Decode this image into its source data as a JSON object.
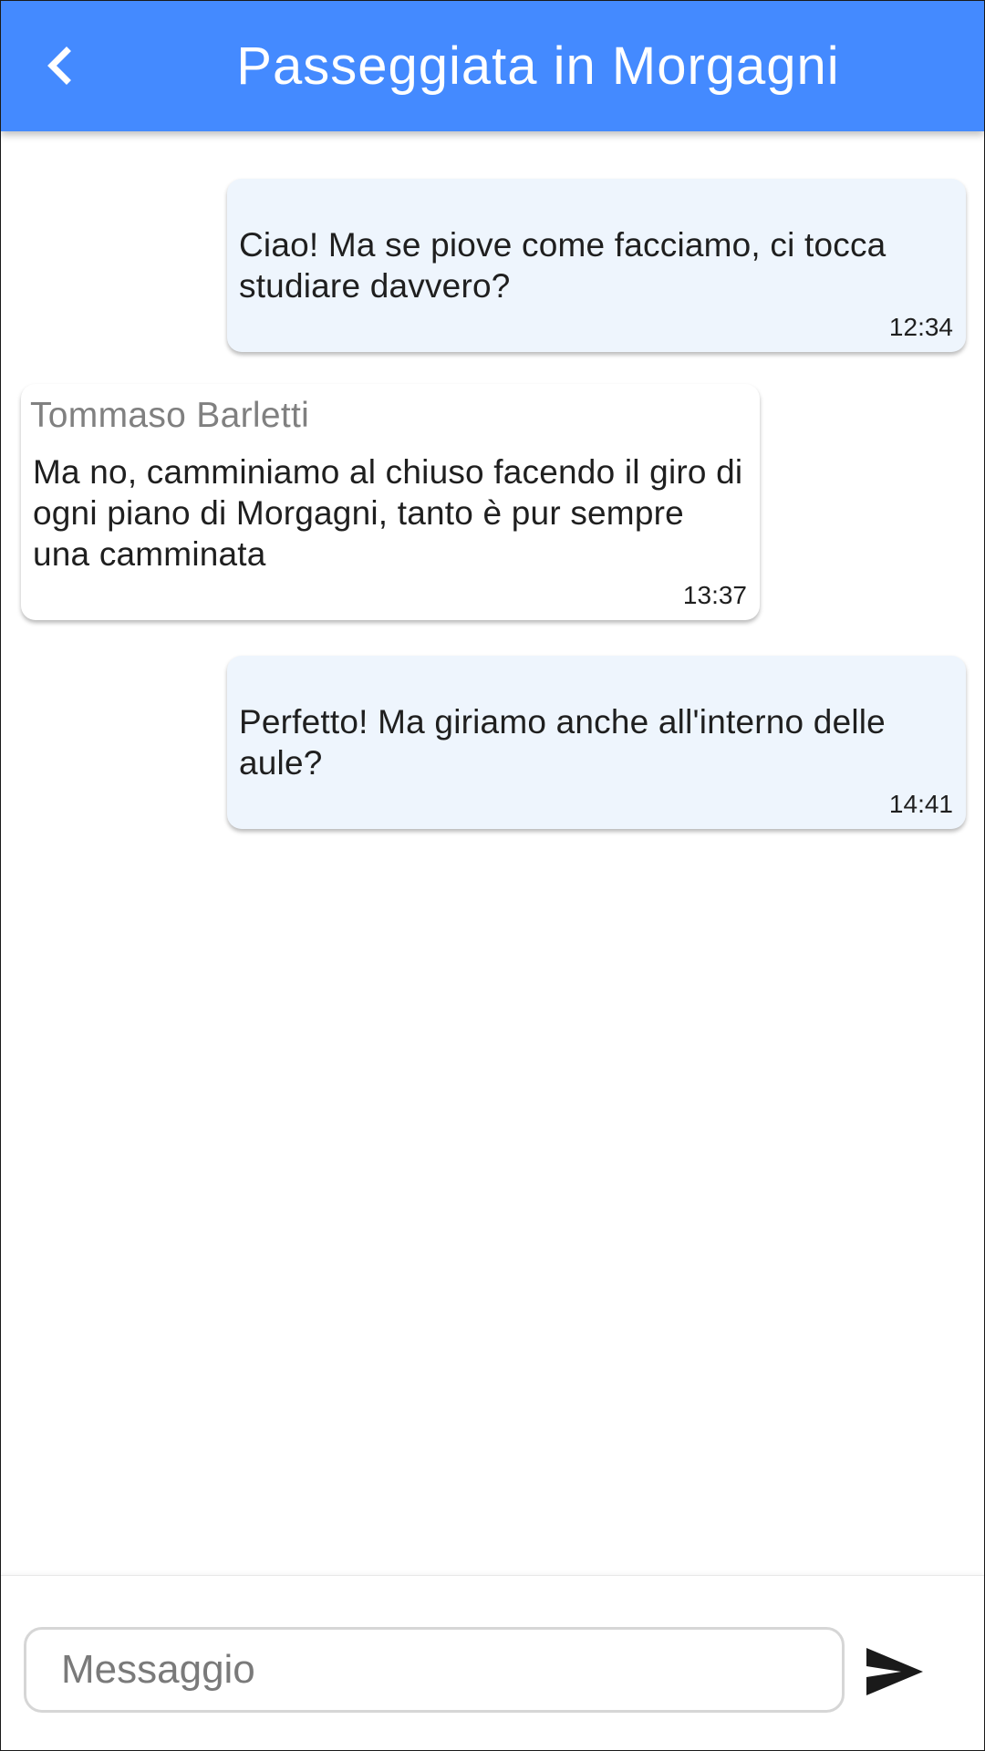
{
  "header": {
    "title": "Passeggiata in Morgagni",
    "back_icon": "chevron-left-icon",
    "background_color": "#448aff"
  },
  "messages": [
    {
      "direction": "outgoing",
      "text": "Ciao! Ma se piove come facciamo, ci tocca studiare davvero?",
      "time": "12:34"
    },
    {
      "direction": "incoming",
      "sender": "Tommaso Barletti",
      "text": "Ma no, camminiamo al chiuso facendo il giro di ogni piano di Morgagni, tanto è pur sempre una camminata",
      "time": "13:37"
    },
    {
      "direction": "outgoing",
      "text": "Perfetto! Ma giriamo anche all'interno delle aule?",
      "time": "14:41"
    }
  ],
  "composer": {
    "placeholder": "Messaggio",
    "value": "",
    "send_icon": "send-icon"
  },
  "colors": {
    "outgoing_bubble": "#eef5fd",
    "incoming_bubble": "#ffffff",
    "sender_name": "#808080"
  }
}
